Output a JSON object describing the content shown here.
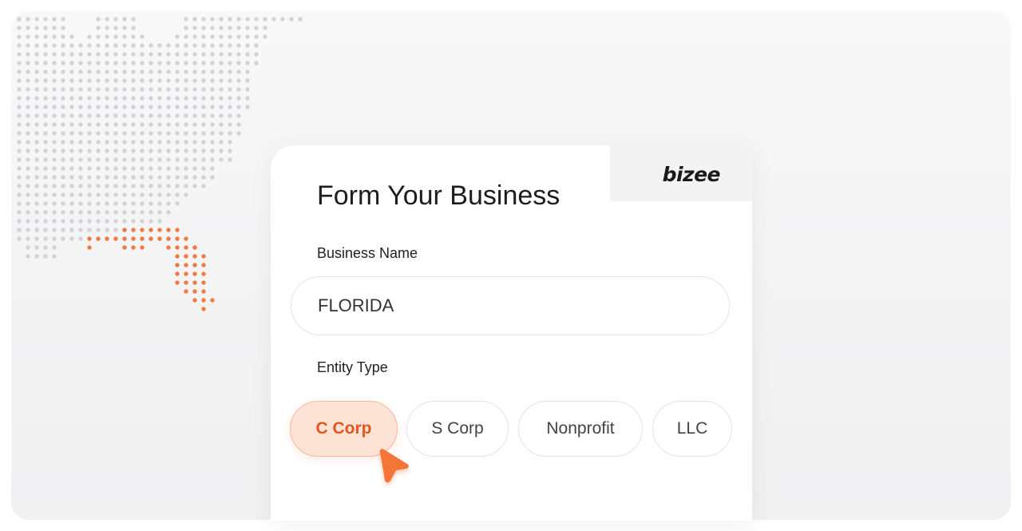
{
  "brand": {
    "logo_text": "bizee"
  },
  "form": {
    "title": "Form Your Business",
    "business_name_label": "Business Name",
    "business_name_value": "FLORIDA",
    "entity_type_label": "Entity Type",
    "entity_options": [
      "C Corp",
      "S Corp",
      "Nonprofit",
      "LLC"
    ],
    "selected_entity": "C Corp"
  },
  "colors": {
    "accent": "#f07a42",
    "accent_light": "#fde3d6",
    "dot_gray": "#d3d3d6"
  },
  "icons": {
    "map": "dotted-us-map-icon",
    "cursor": "pointer-cursor-icon"
  }
}
